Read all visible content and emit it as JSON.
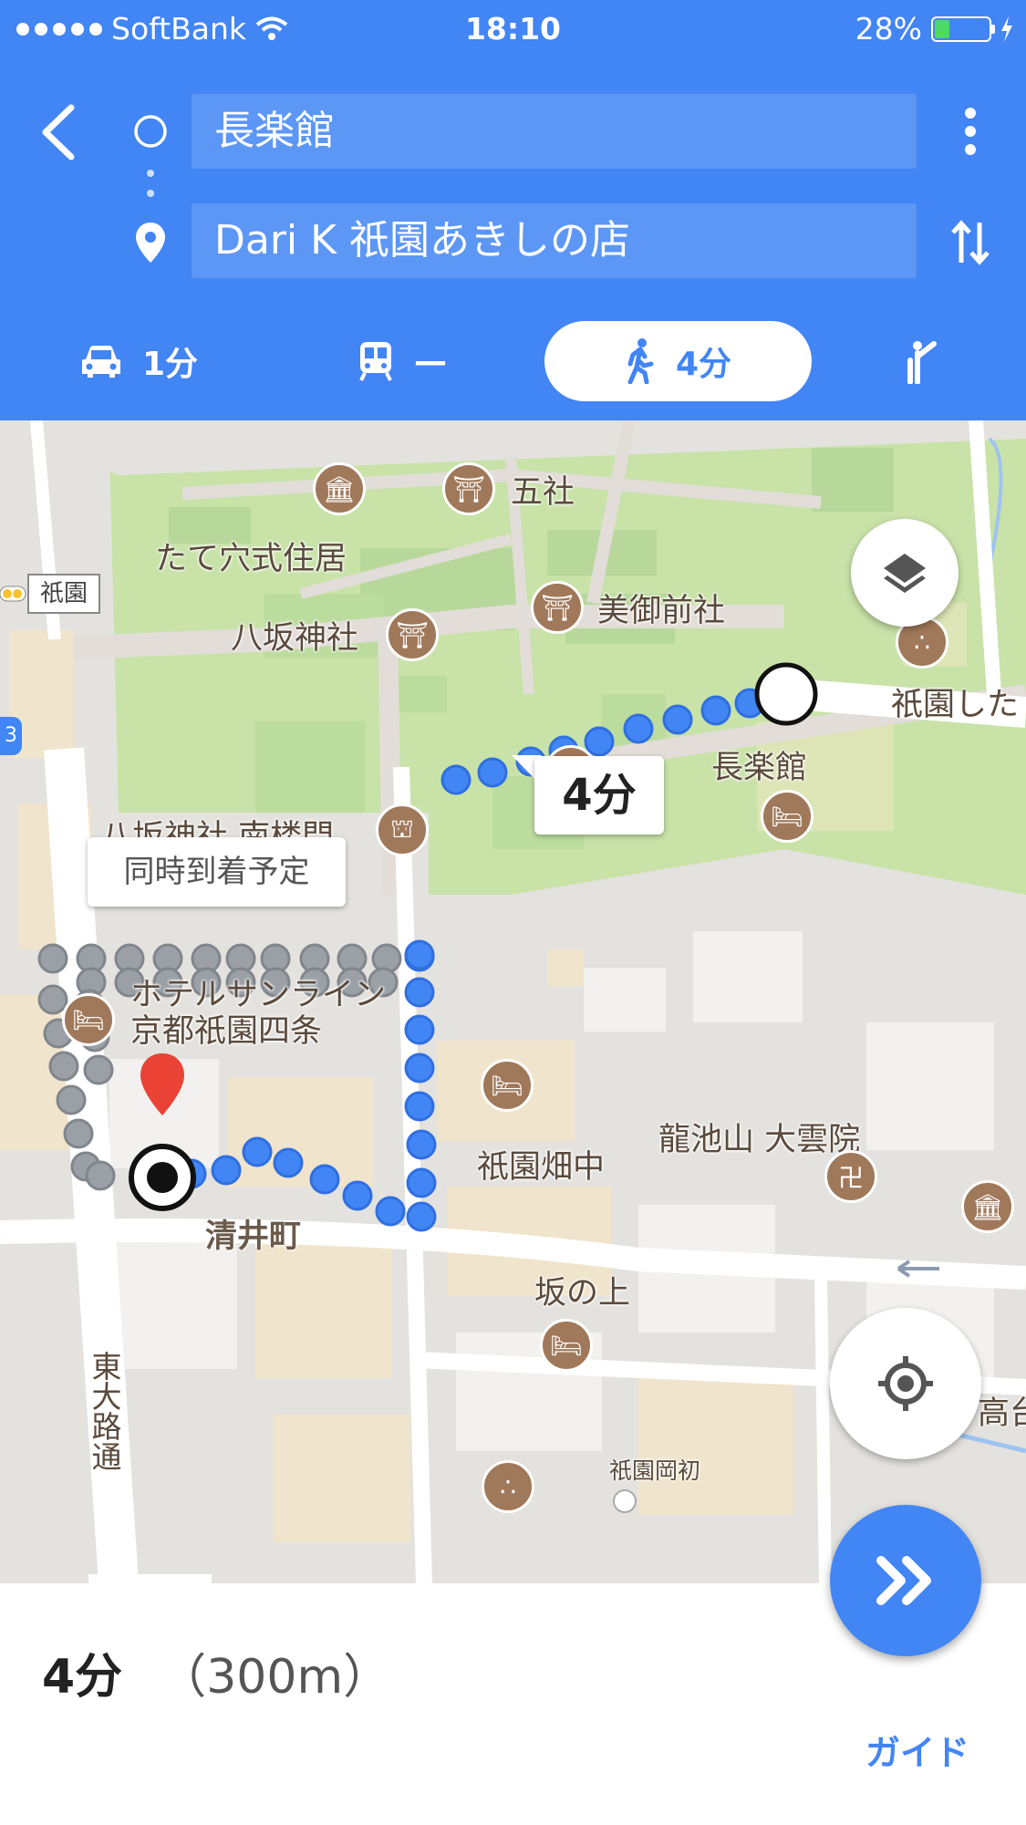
{
  "status_bar": {
    "carrier": "SoftBank",
    "time": "18:10",
    "battery": "28%"
  },
  "route": {
    "origin": "長楽館",
    "destination": "Dari K 祇園あきしの店"
  },
  "modes": [
    {
      "name": "car",
      "label": "1分"
    },
    {
      "name": "transit",
      "label": "—"
    },
    {
      "name": "walk",
      "label": "4分",
      "selected": true
    },
    {
      "name": "ride",
      "label": ""
    }
  ],
  "map": {
    "labels": {
      "goshya": "五社",
      "tateana": "たて穴式住居",
      "gion_sign": "祇園",
      "yasaka": "八坂神社",
      "mimae": "美御前社",
      "gion_shi": "祇園した",
      "chorakukan": "長楽館",
      "nanromon": "八坂神社 南楼門",
      "hotel": "ホテルサンライン\n京都祇園四条",
      "arrival": "同時到着予定",
      "ryuchisan": "龍池山 大雲院",
      "hatanaka": "祇園畑中",
      "kiyoi": "清井町",
      "sakanoue": "坂の上",
      "higashioji": "東大路通",
      "okahatsu": "祇園岡初",
      "taka": "高台",
      "route_badge": "3"
    },
    "route_duration": "4分"
  },
  "summary": {
    "duration": "4分",
    "distance": "（300m）",
    "guide_label": "ガイド"
  },
  "colors": {
    "header": "#4285f4",
    "route": "#4285f4",
    "park": "#c8e2a8"
  }
}
